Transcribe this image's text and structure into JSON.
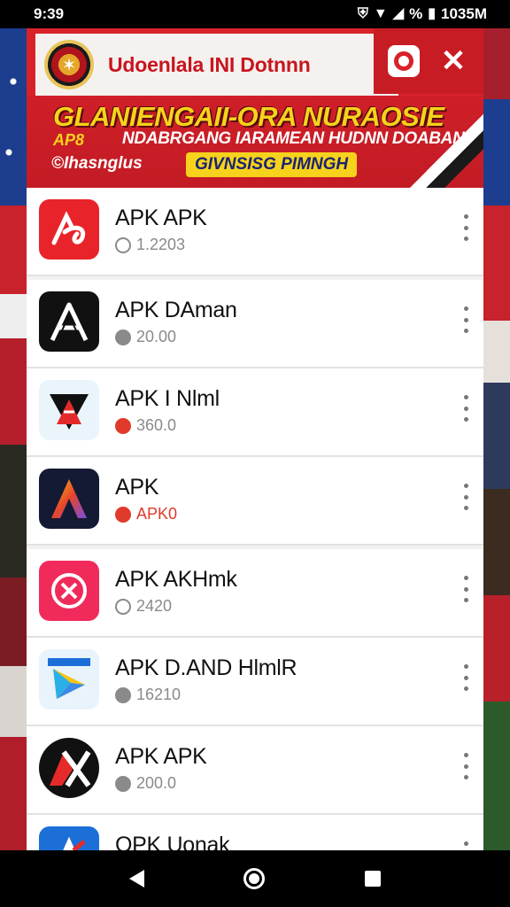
{
  "status_bar": {
    "time": "9:39",
    "battery_text": "%",
    "right_time": "1035M"
  },
  "header": {
    "title": "Udoenlala INI Dotnnn",
    "banner_title": "GLANIENGAII-ORA NURAOSIE",
    "banner_tag": "AP8",
    "banner_sub": "NDABRGANG IARAMEAN HUDNN DOABAN",
    "banner_brand": "©Ihasnglus",
    "banner_pill": "GIVNSISG PIMNGH"
  },
  "apps": [
    {
      "name": "APK APK",
      "meta": "1.2203",
      "meta_icon": "clock-icon",
      "icon": "red-scribble-app-icon"
    },
    {
      "name": "APK DAman",
      "meta": "20.00",
      "meta_icon": "clock-icon",
      "icon": "black-a-app-icon"
    },
    {
      "name": "APK I Nlml",
      "meta": "360.0",
      "meta_icon": "shield-icon",
      "icon": "triangle-a-app-icon"
    },
    {
      "name": "APK",
      "meta": "APK0",
      "meta_icon": "red-shield-icon",
      "icon": "gradient-a-app-icon"
    },
    {
      "name": "APK AKHmk",
      "meta": "2420",
      "meta_icon": "clock-icon",
      "icon": "pink-circle-app-icon"
    },
    {
      "name": "APK D.AND HlmlR",
      "meta": "16210",
      "meta_icon": "clock-icon",
      "icon": "play-store-app-icon"
    },
    {
      "name": "APK APK",
      "meta": "200.0",
      "meta_icon": "clock-icon",
      "icon": "black-ax-app-icon"
    },
    {
      "name": "OPK Uonak",
      "meta": "",
      "meta_icon": "clock-icon",
      "icon": "blue-a-app-icon"
    }
  ],
  "colors": {
    "accent": "#d8222a",
    "banner_yellow": "#f7d21c",
    "meta_grey": "#8a8a8a",
    "meta_red": "#e03a2a"
  }
}
